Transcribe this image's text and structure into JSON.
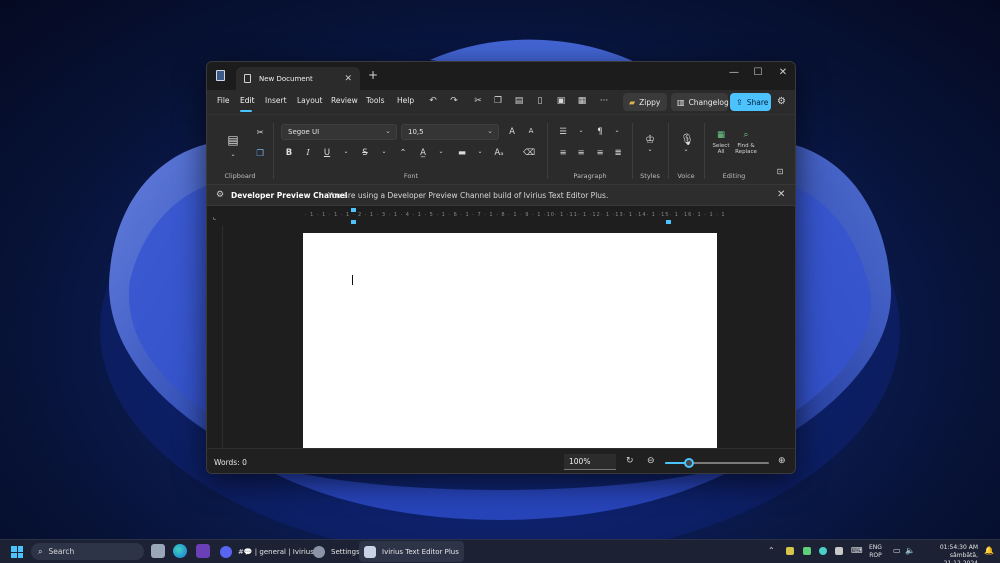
{
  "window": {
    "tab_title": "New Document",
    "tab_close": "✕",
    "new_tab": "+",
    "caption": {
      "minimize": "—",
      "maximize": "☐",
      "close": "✕"
    }
  },
  "menu": {
    "items": [
      "File",
      "Edit",
      "Insert",
      "Layout",
      "Review",
      "Tools",
      "Help"
    ],
    "active": "Edit",
    "zippy": "Zippy",
    "changelog": "Changelog",
    "share": "Share"
  },
  "ribbon": {
    "font_name": "Segoe UI",
    "font_size": "10,5",
    "groups": [
      "Clipboard",
      "Font",
      "Paragraph",
      "Styles",
      "Voice",
      "Editing"
    ],
    "select_all": [
      "Select",
      "All"
    ],
    "find_replace": [
      "Find &",
      "Replace"
    ],
    "buttons": {
      "bold": "B",
      "italic": "I",
      "underline": "U",
      "strike": "S",
      "grow": "A",
      "shrink": "A"
    }
  },
  "infobar": {
    "title": "Developer Preview Channel",
    "message": "You are using a Developer Preview Channel build of Ivirius Text Editor Plus.",
    "close": "✕"
  },
  "ruler": {
    "ticks": "· 1 · 1 · 1 · 1 · 2 · 1 · 3 · 1 · 4 · 1 · 5 · 1 · 6 · 1 · 7 · 1 · 8 · 1 · 9 · 1 ·10· 1 ·11· 1 ·12· 1 ·13· 1 ·14· 1 ·15· 1 ·16· 1 · 1 · 1"
  },
  "status": {
    "words": "Words: 0",
    "zoom": "100%",
    "zoom_level": 0.23
  },
  "taskbar": {
    "search": "Search",
    "discord": "#💬 | general | Ivirius™",
    "settings": "Settings",
    "editor": "Ivirius Text Editor Plus",
    "lang": [
      "ENG",
      "ROP"
    ],
    "time": "01:54:30 AM",
    "date": "sâmbătă, 21.12.2024"
  },
  "colors": {
    "accent": "#4cc2ff",
    "window_bg": "#202020",
    "ribbon_bg": "#2b2b2b",
    "page_bg": "#ffffff"
  }
}
